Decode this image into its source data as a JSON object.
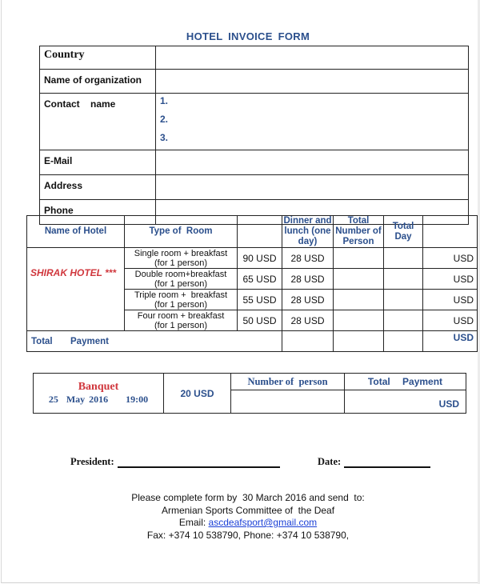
{
  "title": "HOTEL  INVOICE   FORM",
  "contact_table": {
    "rows": [
      {
        "label": "Country",
        "value": ""
      },
      {
        "label": "Name of organization",
        "value": ""
      },
      {
        "label": "Contact    name",
        "items": [
          "1.",
          "2.",
          "3."
        ]
      },
      {
        "label": "E-Mail",
        "value": ""
      },
      {
        "label": "Address",
        "value": ""
      },
      {
        "label": "Phone",
        "value": ""
      }
    ]
  },
  "rooms_table": {
    "headers": [
      "Name of Hotel",
      "Type of  Room",
      "",
      "Dinner and lunch (one day)",
      "Total Number of Person",
      "Total Day",
      ""
    ],
    "hotel_name": "SHIRAK HOTEL ***",
    "rows": [
      {
        "room_line1": "Single room + breakfast",
        "room_line2": "(for 1 person)",
        "price": "90 USD",
        "meals": "28 USD",
        "persons": "",
        "days": "",
        "total": "USD"
      },
      {
        "room_line1": "Double room+breakfast",
        "room_line2": "(for 1 person)",
        "price": "65 USD",
        "meals": "28 USD",
        "persons": "",
        "days": "",
        "total": "USD"
      },
      {
        "room_line1": "Triple room +  breakfast",
        "room_line2": "(for 1 person)",
        "price": "55 USD",
        "meals": "28 USD",
        "persons": "",
        "days": "",
        "total": "USD"
      },
      {
        "room_line1": "Four room + breakfast",
        "room_line2": "(for 1 person)",
        "price": "50 USD",
        "meals": "28 USD",
        "persons": "",
        "days": "",
        "total": "USD"
      }
    ],
    "total_label": "Total  Payment",
    "total_currency": "USD"
  },
  "banquet_table": {
    "title": "Banquet",
    "date": "25  May 2016",
    "time": "19:00",
    "price": "20 USD",
    "number_header": "Number of  person",
    "payment_header": "Total Payment",
    "payment_currency": "USD"
  },
  "signature": {
    "president_label": "President:",
    "date_label": "Date:"
  },
  "footer": {
    "line1": "Please complete form by  30 March 2016 and send  to:",
    "line2": "Armenian Sports Committee of  the Deaf",
    "email_label": "Email: ",
    "email": "ascdeafsport@gmail.com",
    "line4": "Fax: +374 10 538790, Phone: +374 10 538790,"
  }
}
